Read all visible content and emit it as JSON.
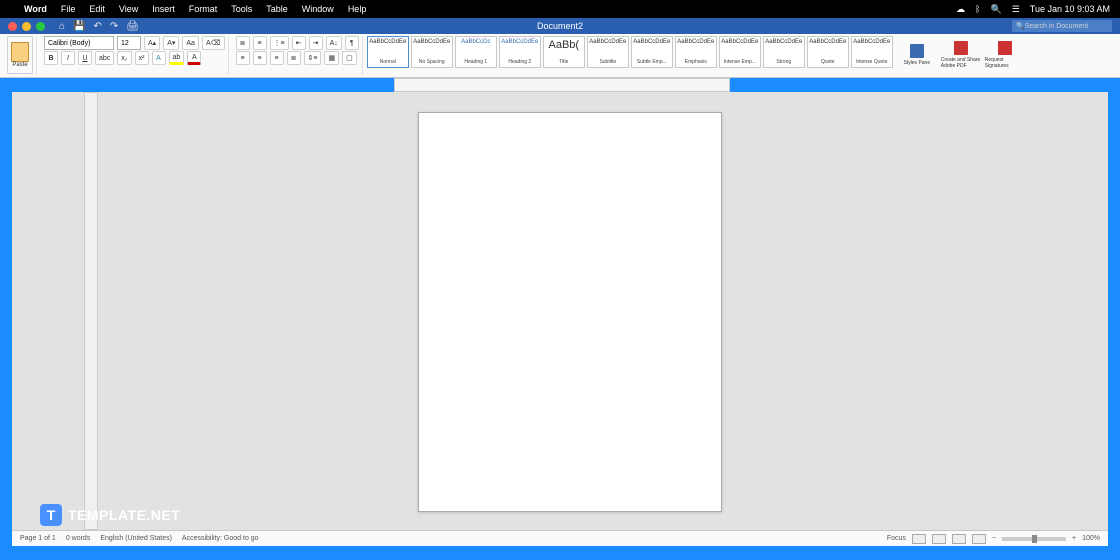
{
  "menubar": {
    "app": "Word",
    "items": [
      "File",
      "Edit",
      "View",
      "Insert",
      "Format",
      "Tools",
      "Table",
      "Window",
      "Help"
    ],
    "clock": "Tue Jan 10  9:03 AM"
  },
  "window": {
    "title": "Document2",
    "search_placeholder": "Search in Document"
  },
  "toolbar": {
    "font": "Calibri (Body)",
    "size": "12",
    "paste": "Paste"
  },
  "styles": [
    {
      "preview": "AaBbCcDdEe",
      "name": "Normal"
    },
    {
      "preview": "AaBbCcDdEe",
      "name": "No Spacing"
    },
    {
      "preview": "AaBbCcDc",
      "name": "Heading 1"
    },
    {
      "preview": "AaBbCcDdEe",
      "name": "Heading 2"
    },
    {
      "preview": "AaBb(",
      "name": "Title"
    },
    {
      "preview": "AaBbCcDdEe",
      "name": "Subtitle"
    },
    {
      "preview": "AaBbCcDdEe",
      "name": "Subtle Emp..."
    },
    {
      "preview": "AaBbCcDdEe",
      "name": "Emphasis"
    },
    {
      "preview": "AaBbCcDdEe",
      "name": "Intense Emp..."
    },
    {
      "preview": "AaBbCcDdEe",
      "name": "Strong"
    },
    {
      "preview": "AaBbCcDdEe",
      "name": "Quote"
    },
    {
      "preview": "AaBbCcDdEe",
      "name": "Intense Quote"
    }
  ],
  "panes": {
    "styles": "Styles Pane",
    "adobe": "Create and Share Adobe PDF",
    "sign": "Request Signatures"
  },
  "status": {
    "page": "Page 1 of 1",
    "words": "0 words",
    "lang": "English (United States)",
    "access": "Accessibility: Good to go",
    "focus": "Focus",
    "zoom": "100%"
  },
  "brand": "TEMPLATE.NET"
}
